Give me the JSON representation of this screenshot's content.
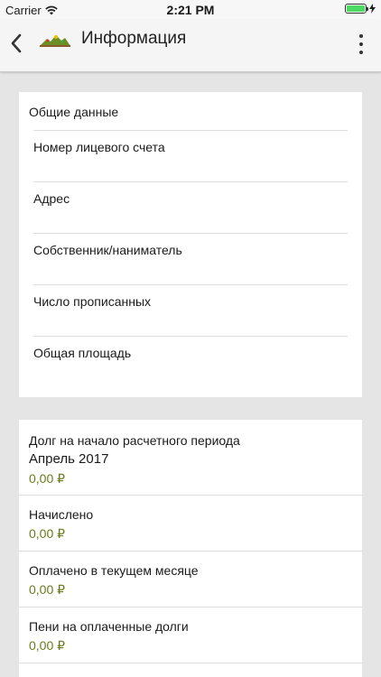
{
  "status_bar": {
    "carrier": "Carrier",
    "time": "2:21 PM"
  },
  "app_bar": {
    "title": "Информация",
    "back_icon": "chevron-left-icon",
    "menu_icon": "more-vertical-icon"
  },
  "general": {
    "title": "Общие данные",
    "fields": [
      {
        "label": "Номер лицевого счета"
      },
      {
        "label": "Адрес"
      },
      {
        "label": "Собственник/наниматель"
      },
      {
        "label": "Число прописанных"
      },
      {
        "label": "Общая площадь"
      }
    ]
  },
  "billing": {
    "items": [
      {
        "label": "Долг на начало расчетного периода",
        "sub": "Апрель 2017",
        "value": "0,00 ₽"
      },
      {
        "label": "Начислено",
        "value": "0,00 ₽"
      },
      {
        "label": "Оплачено в текущем месяце",
        "value": "0,00 ₽"
      },
      {
        "label": "Пени на оплаченные долги",
        "value": "0,00 ₽"
      }
    ]
  },
  "colors": {
    "value_accent": "#6b7b1a",
    "background": "#e5e5e5",
    "battery": "#4cd964"
  }
}
